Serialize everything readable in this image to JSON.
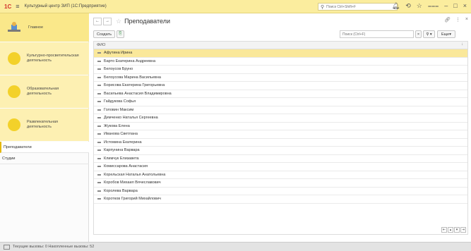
{
  "app": {
    "logo": "1С",
    "title": "Культурный центр ЗИП (1С:Предприятие)",
    "search_placeholder": "Поиск Ctrl+Shift+F"
  },
  "sidebar": {
    "sections": [
      {
        "label": "Главное"
      },
      {
        "label": "Культурно-просветительская деятельность"
      },
      {
        "label": "Образовательная деятельность"
      },
      {
        "label": "Развлекательная деятельность"
      }
    ],
    "nav": [
      {
        "label": "Преподаватели",
        "active": true
      },
      {
        "label": "Студии",
        "active": false
      }
    ]
  },
  "page": {
    "title": "Преподаватели",
    "create_label": "Создать",
    "find_placeholder": "Поиск (Ctrl+F)",
    "more_label": "Еще",
    "column_header": "ФИО",
    "rows": [
      "Афутина Ирина",
      "Барто Екатерина Андреевна",
      "Белоусов Бруно",
      "Белоусова Марина Васильевна",
      "Борисова Екатерина Григорьевна",
      "Васильева Анастасия Владимировна",
      "Гайдукова Софья",
      "Головин Максим",
      "Демченко Наталья Сергеевна",
      "Жукова Елена",
      "Иванова Светлана",
      "Истомина Екатерина",
      "Карпунина Варвара",
      "Климчук Елизавета",
      "Комиссарова Анастасия",
      "Корельская Наталья Анатольевна",
      "Коробов Михаил Вячеславович",
      "Королева Варвара",
      "Коротков Григорий Михайлович"
    ],
    "selected_row": 0
  },
  "status": {
    "text": "Текущие вызовы: 0   Накопленные вызовы: 52"
  },
  "colors": {
    "titlebar": "#fbed9e",
    "selected": "#fae89a",
    "accent": "#f3d12a"
  }
}
